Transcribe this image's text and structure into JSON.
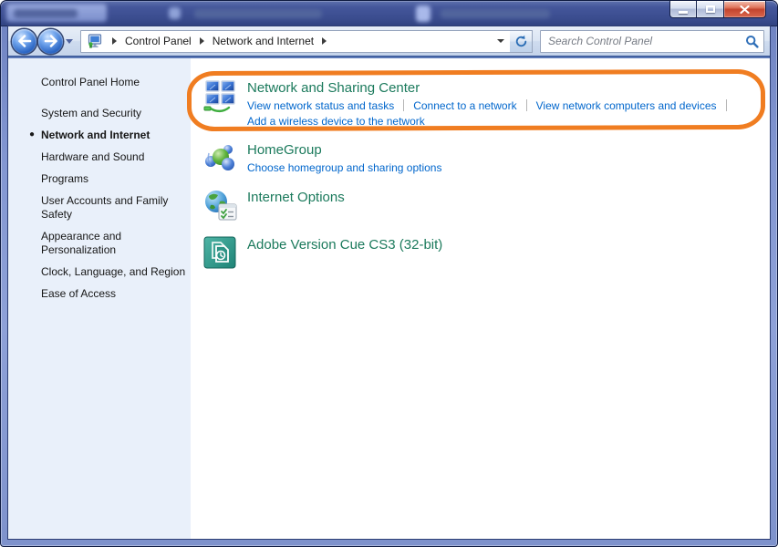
{
  "navbar": {
    "breadcrumb": [
      "Control Panel",
      "Network and Internet"
    ],
    "search_placeholder": "Search Control Panel"
  },
  "sidebar": {
    "home": "Control Panel Home",
    "active_bullet": "●",
    "items": [
      {
        "label": "System and Security",
        "active": false
      },
      {
        "label": "Network and Internet",
        "active": true
      },
      {
        "label": "Hardware and Sound",
        "active": false
      },
      {
        "label": "Programs",
        "active": false
      },
      {
        "label": "User Accounts and Family Safety",
        "active": false
      },
      {
        "label": "Appearance and Personalization",
        "active": false
      },
      {
        "label": "Clock, Language, and Region",
        "active": false
      },
      {
        "label": "Ease of Access",
        "active": false
      }
    ]
  },
  "main": {
    "categories": [
      {
        "title": "Network and Sharing Center",
        "icon": "network-icon",
        "links": [
          "View network status and tasks",
          "Connect to a network",
          "View network computers and devices",
          "Add a wireless device to the network"
        ]
      },
      {
        "title": "HomeGroup",
        "icon": "homegroup-icon",
        "links": [
          "Choose homegroup and sharing options"
        ]
      },
      {
        "title": "Internet Options",
        "icon": "internet-options-icon",
        "links": []
      },
      {
        "title": "Adobe Version Cue CS3 (32-bit)",
        "icon": "adobe-icon",
        "links": []
      }
    ]
  },
  "colors": {
    "highlight_orange": "#F07D21",
    "category_title_green": "#1B7A5C",
    "task_link_blue": "#0066CC"
  }
}
